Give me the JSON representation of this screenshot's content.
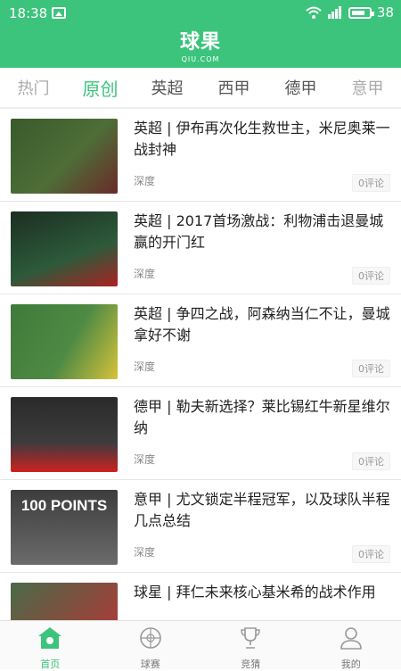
{
  "status": {
    "time": "18:38",
    "battery": "38"
  },
  "header": {
    "logo": "球果",
    "logo_sub": "QIU.COM"
  },
  "tabs": [
    {
      "label": "热门"
    },
    {
      "label": "原创"
    },
    {
      "label": "英超"
    },
    {
      "label": "西甲"
    },
    {
      "label": "德甲"
    },
    {
      "label": "意甲"
    }
  ],
  "articles": [
    {
      "title": "英超 | 伊布再次化生救世主，米尼奥莱一战封神",
      "tag": "深度",
      "comments": "0评论",
      "thumb_colors": [
        "#3a5a2c",
        "#6a2a2a"
      ]
    },
    {
      "title": "英超 | 2017首场激战：利物浦击退曼城赢的开门红",
      "tag": "深度",
      "comments": "0评论",
      "thumb_colors": [
        "#2d5a3a",
        "#a22"
      ]
    },
    {
      "title": "英超 | 争四之战，阿森纳当仁不让，曼城拿好不谢",
      "tag": "深度",
      "comments": "0评论",
      "thumb_colors": [
        "#3f7a3a",
        "#d6c23a"
      ]
    },
    {
      "title": "德甲 | 勒夫新选择？莱比锡红牛新星维尔纳",
      "tag": "深度",
      "comments": "0评论",
      "thumb_colors": [
        "#2a2a2a",
        "#c22"
      ]
    },
    {
      "title": "意甲 | 尤文锁定半程冠军，以及球队半程几点总结",
      "tag": "深度",
      "comments": "0评论",
      "thumb_colors": [
        "#555",
        "#888"
      ],
      "thumb_text": "100 POINTS"
    },
    {
      "title": "球星 | 拜仁未来核心基米希的战术作用",
      "tag": "",
      "comments": "",
      "thumb_colors": [
        "#4a6a4a",
        "#b33"
      ]
    }
  ],
  "nav": [
    {
      "label": "首页",
      "icon": "home-icon"
    },
    {
      "label": "球赛",
      "icon": "ball-icon"
    },
    {
      "label": "竞猜",
      "icon": "trophy-icon"
    },
    {
      "label": "我的",
      "icon": "user-icon"
    }
  ],
  "colors": {
    "accent": "#3cc47c"
  }
}
